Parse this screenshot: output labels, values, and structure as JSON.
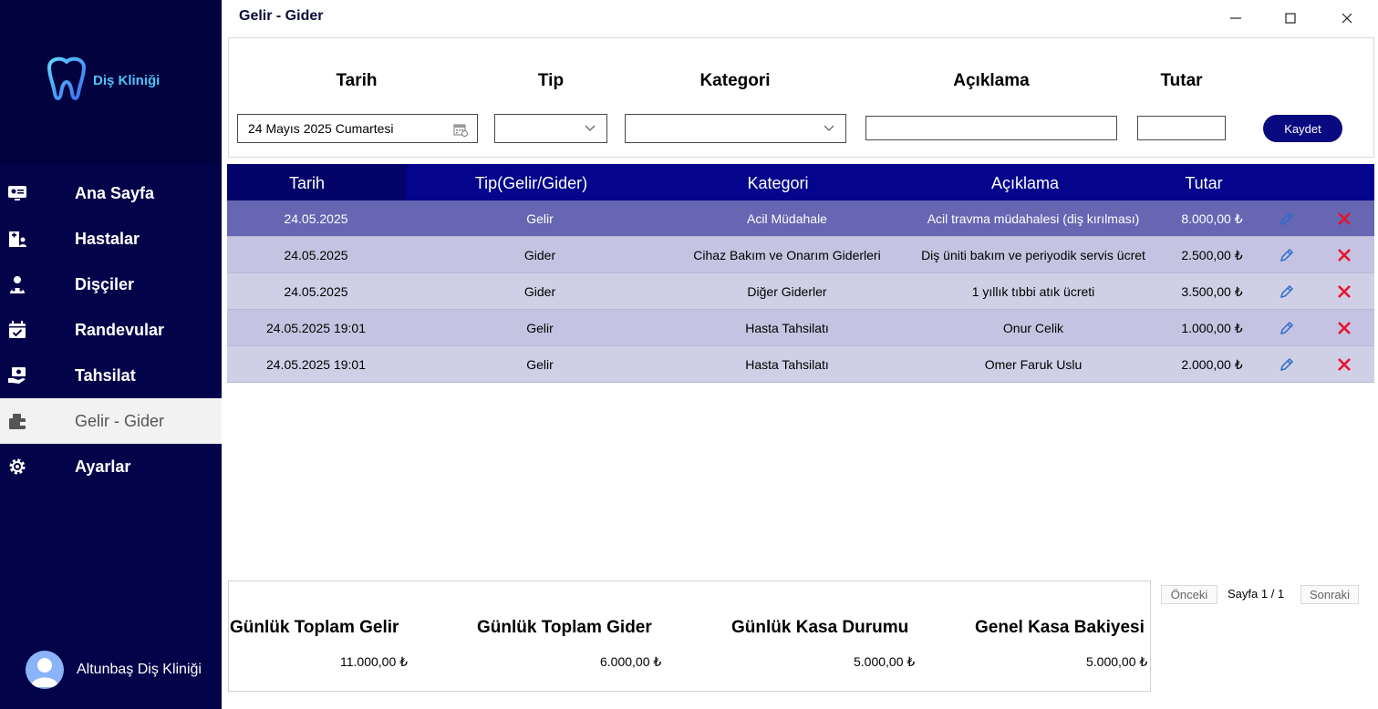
{
  "app": {
    "title": "Gelir - Gider",
    "logo_text": "Diş Kliniği"
  },
  "sidebar": {
    "items": [
      {
        "label": "Ana Sayfa",
        "icon": "dashboard-icon"
      },
      {
        "label": "Hastalar",
        "icon": "patients-icon"
      },
      {
        "label": "Dişçiler",
        "icon": "dentists-icon"
      },
      {
        "label": "Randevular",
        "icon": "calendar-icon"
      },
      {
        "label": "Tahsilat",
        "icon": "payment-icon"
      },
      {
        "label": "Gelir - Gider",
        "icon": "wallet-icon",
        "active": true
      },
      {
        "label": "Ayarlar",
        "icon": "gear-icon"
      }
    ],
    "user_name": "Altunbaş Diş Kliniği"
  },
  "form": {
    "labels": {
      "tarih": "Tarih",
      "tip": "Tip",
      "kategori": "Kategori",
      "aciklama": "Açıklama",
      "tutar": "Tutar"
    },
    "date_value": "24 Mayıs 2025 Cumartesi",
    "tip_value": "",
    "kategori_value": "",
    "aciklama_value": "",
    "tutar_value": "",
    "save_label": "Kaydet"
  },
  "table": {
    "headers": {
      "tarih": "Tarih",
      "tip": "Tip(Gelir/Gider)",
      "kategori": "Kategori",
      "aciklama": "Açıklama",
      "tutar": "Tutar"
    },
    "rows": [
      {
        "tarih": "24.05.2025",
        "tip": "Gelir",
        "kategori": "Acil Müdahale",
        "aciklama": "Acil travma müdahalesi (diş kırılması)",
        "tutar": "8.000,00 ₺"
      },
      {
        "tarih": "24.05.2025",
        "tip": "Gider",
        "kategori": "Cihaz Bakım ve Onarım Giderleri",
        "aciklama": "Diş üniti bakım ve periyodik servis ücret",
        "tutar": "2.500,00 ₺"
      },
      {
        "tarih": "24.05.2025",
        "tip": "Gider",
        "kategori": "Diğer Giderler",
        "aciklama": "1 yıllık tıbbi atık ücreti",
        "tutar": "3.500,00 ₺"
      },
      {
        "tarih": "24.05.2025 19:01",
        "tip": "Gelir",
        "kategori": "Hasta Tahsilatı",
        "aciklama": "Onur Celik",
        "tutar": "1.000,00 ₺"
      },
      {
        "tarih": "24.05.2025 19:01",
        "tip": "Gelir",
        "kategori": "Hasta Tahsilatı",
        "aciklama": "Omer Faruk Uslu",
        "tutar": "2.000,00 ₺"
      }
    ]
  },
  "summary": {
    "gelir_label": "Günlük Toplam Gelir",
    "gelir_value": "11.000,00 ₺",
    "gider_label": "Günlük Toplam Gider",
    "gider_value": "6.000,00 ₺",
    "kasa_label": "Günlük Kasa Durumu",
    "kasa_value": "5.000,00 ₺",
    "genel_label": "Genel Kasa Bakiyesi",
    "genel_value": "5.000,00 ₺"
  },
  "pager": {
    "prev_label": "Önceki",
    "page_text": "Sayfa 1 / 1",
    "next_label": "Sonraki"
  },
  "colors": {
    "sidebar_bg": "#03034a",
    "header_bg": "#04048c",
    "row_highlight": "#6666b3",
    "row_normal": "#c4c4e2",
    "row_alt": "#cfcfe6",
    "delete_red": "#e8112d",
    "edit_blue": "#2a6cc7"
  }
}
